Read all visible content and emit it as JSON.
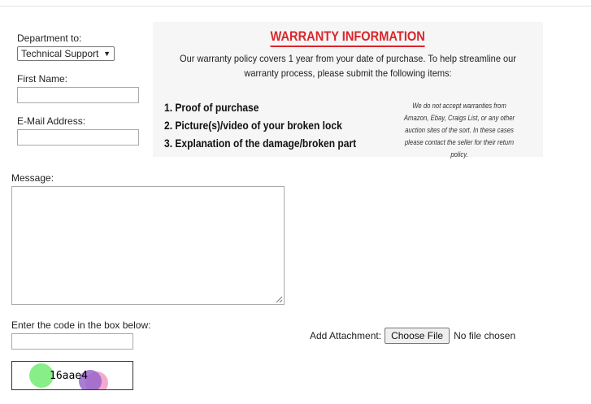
{
  "form": {
    "department_label": "Department to:",
    "department_value": "Technical Support",
    "first_name_label": "First Name:",
    "first_name_value": "",
    "email_label": "E-Mail Address:",
    "email_value": "",
    "message_label": "Message:",
    "message_value": "",
    "code_label": "Enter the code in the box below:",
    "code_value": "",
    "captcha_text": "16aae4",
    "attachment_label": "Add Attachment:",
    "choose_file_label": "Choose File",
    "no_file_text": "No file chosen"
  },
  "warranty": {
    "title": "WARRANTY INFORMATION",
    "intro": "Our warranty policy covers 1 year from your date of purchase. To help streamline our warranty process, please submit the following items:",
    "items": [
      "1. Proof of purchase",
      "2. Picture(s)/video of your broken lock",
      "3. Explanation of the damage/broken part"
    ],
    "note": "We do not accept warranties from Amazon, Ebay, Craigs List, or any other auction sites of the sort. In these cases please contact the seller for their return policy."
  },
  "colors": {
    "accent_red": "#d9262b",
    "panel_bg": "#f6f6f6",
    "captcha_green": "#88ee88",
    "captcha_purple": "#9966cc",
    "captcha_pink": "#f2a0c8"
  }
}
